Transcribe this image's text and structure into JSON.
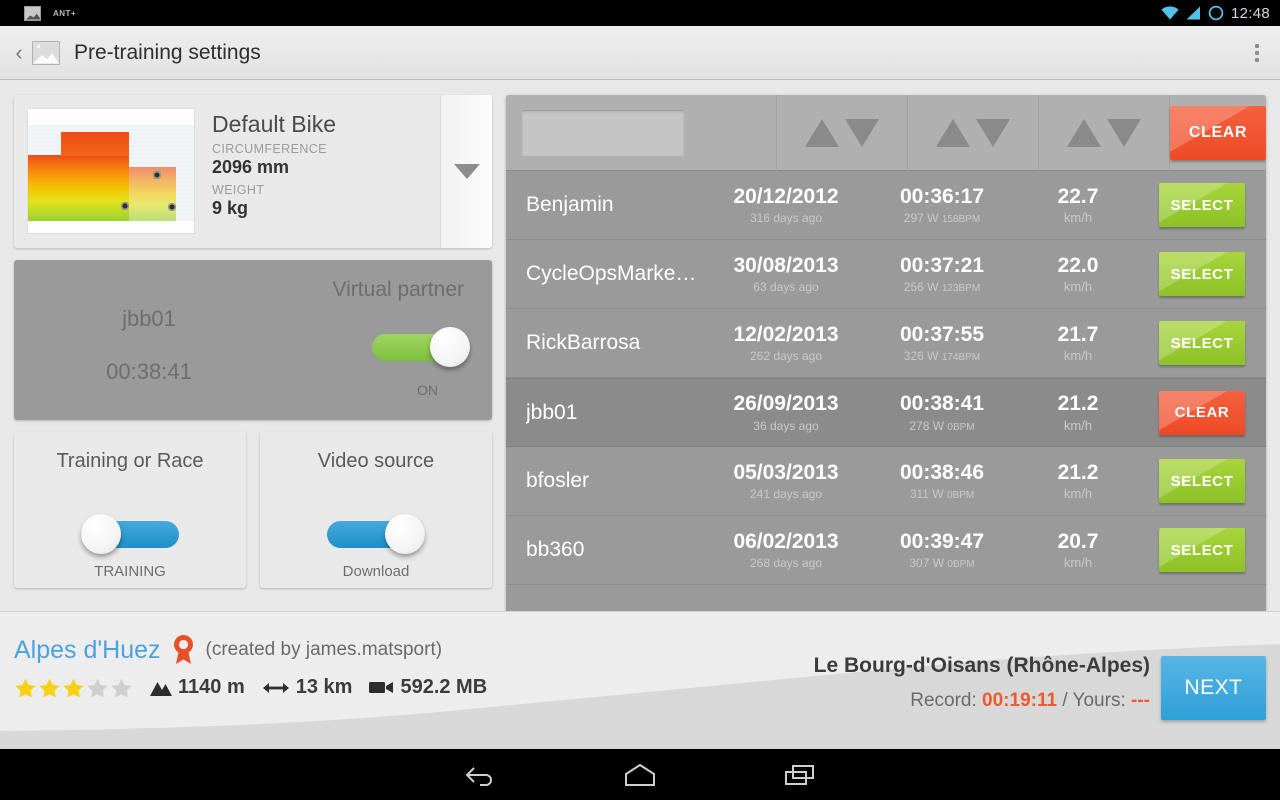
{
  "status_bar": {
    "app_name": "ANT+",
    "clock": "12:48",
    "icons": [
      "app-notification-icon",
      "wifi-icon",
      "signal-icon",
      "battery-icon"
    ]
  },
  "action_bar": {
    "back_glyph": "‹",
    "title": "Pre-training settings",
    "overflow_label": "overflow-menu"
  },
  "bike_card": {
    "name": "Default Bike",
    "circumference_label": "CIRCUMFERENCE",
    "circumference_value": "2096 mm",
    "weight_label": "WEIGHT",
    "weight_value": "9 kg",
    "expand_glyph": "▼"
  },
  "virtual_partner": {
    "title": "Virtual partner",
    "name": "jbb01",
    "time": "00:38:41",
    "state": "ON",
    "toggle_on": true,
    "accent": "#8cc63f"
  },
  "training_card": {
    "title": "Training or Race",
    "state": "TRAINING",
    "toggle_on": false,
    "accent": "#2f9fd8"
  },
  "video_card": {
    "title": "Video source",
    "state": "Download",
    "toggle_on": true,
    "accent": "#2f9fd8"
  },
  "table": {
    "search_value": "",
    "search_placeholder": "",
    "sort_columns": [
      "date",
      "time",
      "speed"
    ],
    "clear_all_label": "CLEAR",
    "select_label": "SELECT",
    "clear_label": "CLEAR",
    "rows": [
      {
        "name": "Benjamin",
        "date": "20/12/2012",
        "days_ago": "316 days ago",
        "time": "00:36:17",
        "power": "297 W",
        "bpm": "158BPM",
        "speed": "22.7",
        "unit": "km/h",
        "action": "SELECT",
        "selected": false
      },
      {
        "name": "CycleOpsMarke…",
        "date": "30/08/2013",
        "days_ago": "63 days ago",
        "time": "00:37:21",
        "power": "256 W",
        "bpm": "123BPM",
        "speed": "22.0",
        "unit": "km/h",
        "action": "SELECT",
        "selected": false
      },
      {
        "name": "RickBarrosa",
        "date": "12/02/2013",
        "days_ago": "262 days ago",
        "time": "00:37:55",
        "power": "326 W",
        "bpm": "174BPM",
        "speed": "21.7",
        "unit": "km/h",
        "action": "SELECT",
        "selected": false
      },
      {
        "name": "jbb01",
        "date": "26/09/2013",
        "days_ago": "36 days ago",
        "time": "00:38:41",
        "power": "278 W",
        "bpm": "0BPM",
        "speed": "21.2",
        "unit": "km/h",
        "action": "CLEAR",
        "selected": true
      },
      {
        "name": "bfosler",
        "date": "05/03/2013",
        "days_ago": "241 days ago",
        "time": "00:38:46",
        "power": "311 W",
        "bpm": "0BPM",
        "speed": "21.2",
        "unit": "km/h",
        "action": "SELECT",
        "selected": false
      },
      {
        "name": "bb360",
        "date": "06/02/2013",
        "days_ago": "268 days ago",
        "time": "00:39:47",
        "power": "307 W",
        "bpm": "0BPM",
        "speed": "20.7",
        "unit": "km/h",
        "action": "SELECT",
        "selected": false
      }
    ]
  },
  "footer": {
    "course_name": "Alpes d'Huez",
    "author": "(created by james.matsport)",
    "rating": 3,
    "rating_max": 5,
    "elevation": "1140 m",
    "distance": "13 km",
    "filesize": "592.2 MB",
    "location": "Le Bourg-d'Oisans (Rhône-Alpes)",
    "record_label": "Record:",
    "record_value": "00:19:11",
    "yours_label": "/ Yours:",
    "yours_value": "---",
    "next_label": "NEXT",
    "course_color": "#4aa3df",
    "record_color": "#ef5a2a"
  },
  "nav_bar": {
    "buttons": [
      "back-nav-icon",
      "home-nav-icon",
      "recents-nav-icon"
    ]
  }
}
